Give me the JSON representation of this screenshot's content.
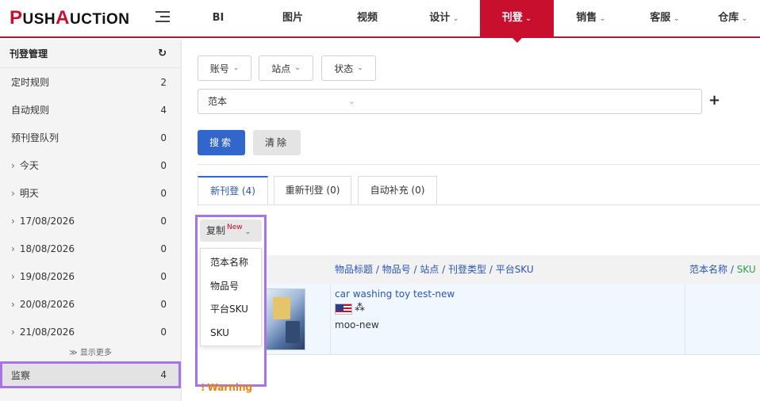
{
  "app": {
    "logo_parts": [
      "P",
      "USH",
      "A",
      "UCTiON"
    ]
  },
  "nav": {
    "items": [
      {
        "label": "BI",
        "has_dropdown": false
      },
      {
        "label": "图片",
        "has_dropdown": false
      },
      {
        "label": "视频",
        "has_dropdown": false
      },
      {
        "label": "设计",
        "has_dropdown": true
      },
      {
        "label": "刊登",
        "has_dropdown": true,
        "active": true
      },
      {
        "label": "销售",
        "has_dropdown": true
      },
      {
        "label": "客服",
        "has_dropdown": true
      },
      {
        "label": "仓库",
        "has_dropdown": true
      }
    ],
    "chevron": "⌄",
    "accent_color": "#c8102e"
  },
  "sidebar": {
    "header": "刊登管理",
    "refresh_icon": "↻",
    "items": [
      {
        "label": "定时规则",
        "count": "2"
      },
      {
        "label": "自动规则",
        "count": "4"
      },
      {
        "label": "预刊登队列",
        "count": "0"
      },
      {
        "label": "今天",
        "count": "0",
        "expandable": true
      },
      {
        "label": "明天",
        "count": "0",
        "expandable": true
      },
      {
        "label": "17/08/2026",
        "count": "0",
        "expandable": true
      },
      {
        "label": "18/08/2026",
        "count": "0",
        "expandable": true
      },
      {
        "label": "19/08/2026",
        "count": "0",
        "expandable": true
      },
      {
        "label": "20/08/2026",
        "count": "0",
        "expandable": true
      },
      {
        "label": "21/08/2026",
        "count": "0",
        "expandable": true
      }
    ],
    "expand_arrow": "›",
    "show_more": "≫ 显示更多",
    "monitor": {
      "label": "监察",
      "count": "4"
    }
  },
  "filters": {
    "account": "账号",
    "site": "站点",
    "status": "状态",
    "chevron": "⌄",
    "template_select": "范本",
    "template_placeholder": "",
    "plus": "+",
    "search_button": "搜索",
    "clear_button": "清除"
  },
  "tabs": [
    {
      "label": "新刊登 (4)",
      "active": true
    },
    {
      "label": "重新刊登 (0)"
    },
    {
      "label": "自动补充 (0)"
    }
  ],
  "copy": {
    "label": "复制",
    "badge": "New",
    "chevron": "⌄",
    "menu": [
      "范本名称",
      "物品号",
      "平台SKU",
      "SKU"
    ]
  },
  "table": {
    "header_title": "物品标题 / 物品号 / 站点 / 刊登类型 / 平台SKU",
    "header_template_prefix": "范本名称 / ",
    "header_template_sku": "SKU",
    "rows": [
      {
        "title": "car washing toy test-new",
        "sku": "moo-new",
        "site_flag": "us-flag-icon",
        "variation_icon": "⁂"
      }
    ]
  },
  "warning": {
    "icon": "!",
    "label": "Warning"
  }
}
